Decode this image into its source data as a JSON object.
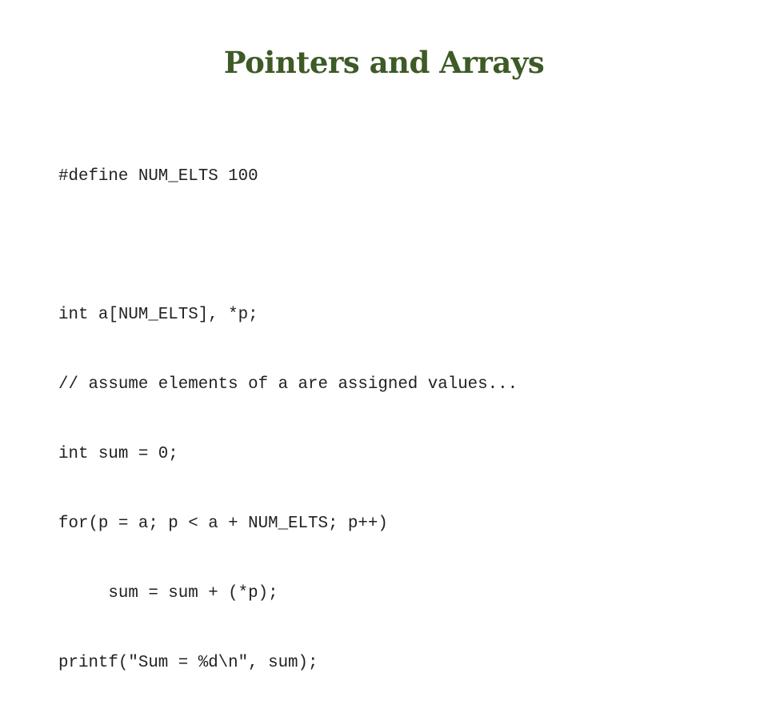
{
  "slide": {
    "title": "Pointers and Arrays",
    "title_color": "#3d5a27",
    "code_lines": [
      "#define NUM_ELTS 100",
      "",
      "int a[NUM_ELTS], *p;",
      "// assume elements of a are assigned values...",
      "int sum = 0;",
      "for(p = a; p < a + NUM_ELTS; p++)",
      "     sum = sum + (*p);",
      "printf(\"Sum = %d\\n\", sum);"
    ]
  }
}
